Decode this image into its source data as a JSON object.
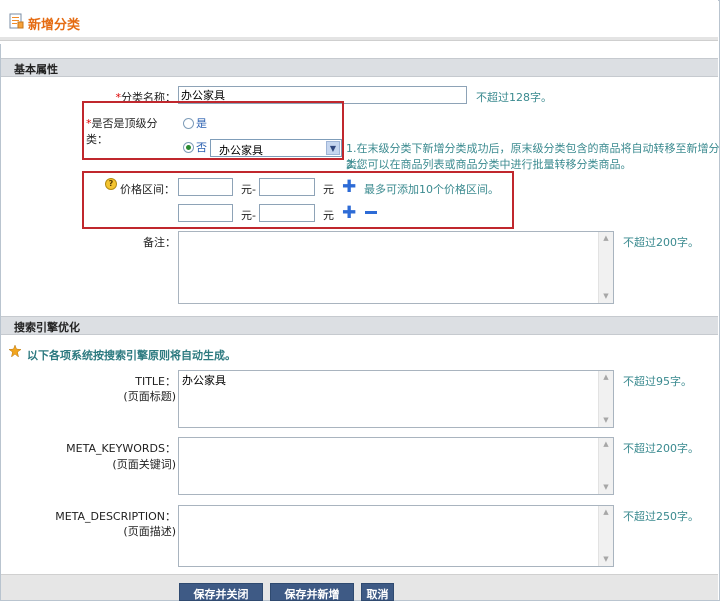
{
  "page": {
    "title": "新增分类",
    "icon": "document-icon"
  },
  "basic": {
    "header": "基本属性",
    "name_label": "分类名称：",
    "name_value": "办公家具",
    "name_hint": "不超过128字。",
    "toplevel_label": "是否是顶级分类：",
    "radio_yes": "是",
    "radio_no": "否",
    "selected": "no",
    "parent_select": "办公家具",
    "toplevel_hint_1": "1.在末级分类下新增分类成功后，原末级分类包含的商品将自动转移至新增分类。",
    "toplevel_hint_2": "2.您可以在商品列表或商品分类中进行批量转移分类商品。",
    "price_label": "价格区间：",
    "price_unit_from": "元-",
    "price_unit_to": "元",
    "price_hint": "最多可添加10个价格区间。",
    "remark_label": "备注：",
    "remark_hint": "不超过200字。"
  },
  "seo": {
    "header": "搜索引擎优化",
    "note": "以下各项系统按搜索引擎原则将自动生成。",
    "title_label": "TITLE：",
    "title_sub": "(页面标题)",
    "title_value": "办公家具",
    "title_hint": "不超过95字。",
    "keywords_label": "META_KEYWORDS：",
    "keywords_sub": "(页面关键词)",
    "keywords_hint": "不超过200字。",
    "desc_label": "META_DESCRIPTION：",
    "desc_sub": "(页面描述)",
    "desc_hint": "不超过250字。"
  },
  "buttons": {
    "save_close": "保存并关闭",
    "save_new": "保存并新增",
    "cancel": "取消"
  },
  "colors": {
    "title": "#e56b12",
    "hint": "#3a8a8f",
    "highlight_box": "#c0272d",
    "button": "#3e5a85"
  }
}
